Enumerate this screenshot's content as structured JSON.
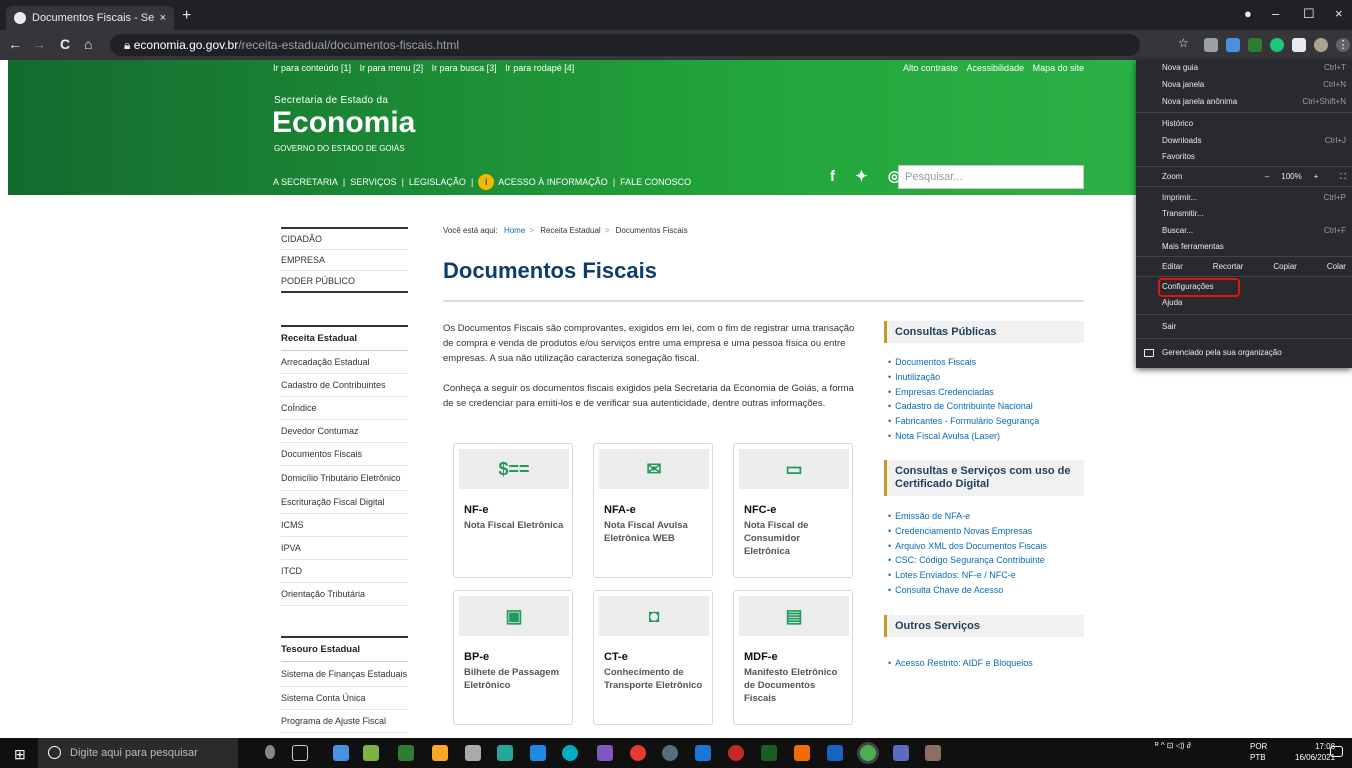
{
  "browser": {
    "tab_title": "Documentos Fiscais - Secretaria d",
    "tab_close": "×",
    "new_tab": "+",
    "win_min": "–",
    "win_max": "☐",
    "win_close": "×",
    "url_domain": "economia.go.gov.br",
    "url_path": "/receita-estadual/documentos-fiscais.html",
    "back": "←",
    "forward": "→",
    "reload": "C",
    "home": "⌂"
  },
  "site": {
    "accessibility_links": [
      "Ir para conteúdo [1]",
      "Ir para menu [2]",
      "Ir para busca [3]",
      "Ir para rodapé [4]"
    ],
    "top_right_links": [
      "Alto contraste",
      "Acessibilidade",
      "Mapa do site"
    ],
    "secretaria": "Secretaria de Estado da",
    "economia": "Economia",
    "governo": "GOVERNO DO ESTADO DE GOIÁS",
    "nav": [
      "A SECRETARIA",
      "SERVIÇOS",
      "LEGISLAÇÃO",
      "ACESSO À INFORMAÇÃO",
      "FALE CONOSCO"
    ],
    "nav_sep": "|",
    "social": "f ✦ ◎",
    "search_placeholder": "Pesquisar..."
  },
  "sidebar": {
    "top": [
      "CIDADÃO",
      "EMPRESA",
      "PODER PÚBLICO"
    ],
    "receita_heading": "Receita Estadual",
    "receita_items": [
      "Arrecadação Estadual",
      "Cadastro de Contribuintes",
      "CoÍndice",
      "Devedor Contumaz",
      "Documentos Fiscais",
      "Domicílio Tributário Eletrônico",
      "Escrituração Fiscal Digital",
      "ICMS",
      "IPVA",
      "ITCD",
      "Orientação Tributária"
    ],
    "tesouro_heading": "Tesouro Estadual",
    "tesouro_items": [
      "Sistema de Finanças Estaduais",
      "Sistema Conta Única",
      "Programa de Ajuste Fiscal"
    ]
  },
  "main": {
    "breadcrumb_label": "Você está aqui:",
    "breadcrumb": [
      "Home",
      "Receita Estadual",
      "Documentos Fiscais"
    ],
    "breadcrumb_sep": ">",
    "title": "Documentos Fiscais",
    "para1": "Os Documentos Fiscais são comprovantes, exigidos em lei, com o fim de registrar uma transação de compra e venda de produtos e/ou serviços entre uma empresa e uma pessoa física ou entre empresas. A sua não utilização caracteriza sonegação fiscal.",
    "para2": "Conheça a seguir os documentos fiscais exigidos pela Secretaria da Economia de Goiás, a forma de se credenciar para emiti-los e de verificar sua autenticidade, dentre outras informações.",
    "cards": [
      {
        "icon": "$==",
        "title": "NF-e",
        "subtitle": "Nota Fiscal Eletrônica"
      },
      {
        "icon": "✉",
        "title": "NFA-e",
        "subtitle": "Nota Fiscal Avulsa Eletrônica WEB"
      },
      {
        "icon": "▭",
        "title": "NFC-e",
        "subtitle": "Nota Fiscal de Consumidor Eletrônica"
      },
      {
        "icon": "▣",
        "title": "BP-e",
        "subtitle": "Bilhete de Passagem Eletrônico"
      },
      {
        "icon": "◘",
        "title": "CT-e",
        "subtitle": "Conhecimento de Transporte Eletrônico"
      },
      {
        "icon": "▤",
        "title": "MDF-e",
        "subtitle": "Manifesto Eletrônico de Documentos Fiscais"
      }
    ]
  },
  "right": {
    "consultas_heading": "Consultas Públicas",
    "consultas_items": [
      "Documentos Fiscais",
      "Inutilização",
      "Empresas Credenciadas",
      "Cadastro de Contribuinte Nacional",
      "Fabricantes - Formulário Segurança",
      "Nota Fiscal Avulsa (Laser)"
    ],
    "cert_heading": "Consultas e Serviços com uso de Certificado Digital",
    "cert_items": [
      "Emissão de NFA-e",
      "Credenciamento Novas Empresas",
      "Arquivo XML dos Documentos Fiscais",
      "CSC: Código Segurança Contribuinte",
      "Lotes Enviados: NF-e / NFC-e",
      "Consulta Chave de Acesso"
    ],
    "outros_heading": "Outros Serviços",
    "outros_items": [
      "Acesso Restrito: AIDF e Bloqueios"
    ]
  },
  "menu": {
    "nova_guia": "Nova guia",
    "nova_guia_k": "Ctrl+T",
    "nova_janela": "Nova janela",
    "nova_janela_k": "Ctrl+N",
    "anonima": "Nova janela anônima",
    "anonima_k": "Ctrl+Shift+N",
    "historico": "Histórico",
    "downloads": "Downloads",
    "downloads_k": "Ctrl+J",
    "favoritos": "Favoritos",
    "zoom": "Zoom",
    "zoom_minus": "–",
    "zoom_value": "100%",
    "zoom_plus": "+",
    "zoom_full": "⛶",
    "imprimir": "Imprimir...",
    "imprimir_k": "Ctrl+P",
    "transmitir": "Transmitir...",
    "buscar": "Buscar...",
    "buscar_k": "Ctrl+F",
    "mais": "Mais ferramentas",
    "editar": "Editar",
    "recortar": "Recortar",
    "copiar": "Copiar",
    "colar": "Colar",
    "configuracoes": "Configurações",
    "ajuda": "Ajuda",
    "sair": "Sair",
    "gerenciado": "Gerenciado pela sua organização"
  },
  "taskbar": {
    "search_placeholder": "Digite aqui para pesquisar",
    "lang1": "POR",
    "lang2": "PTB",
    "time": "17:08",
    "date": "16/06/2021",
    "tray": "ᴿ ^ ⊡ ◁) ∂"
  },
  "colors": {
    "header_green": "#22a53b",
    "title_blue": "#0e3d6b",
    "link_blue": "#0a6ab8",
    "highlight_red": "#e0151a"
  }
}
